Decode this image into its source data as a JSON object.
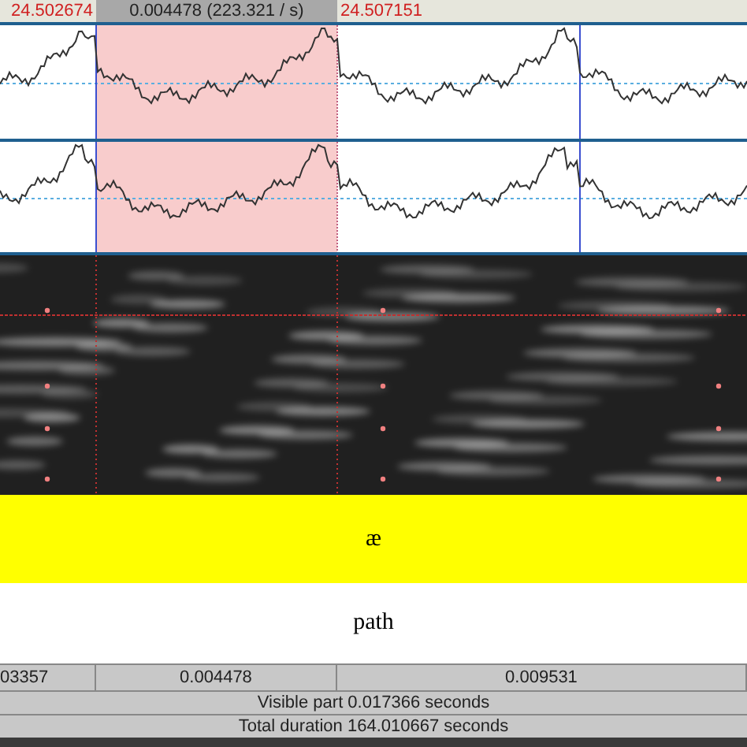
{
  "header": {
    "start_time": "24.502674",
    "selection_duration": "0.004478 (223.321 / s)",
    "end_time": "24.507151"
  },
  "channels": [
    {
      "kind": "waveform"
    },
    {
      "kind": "waveform"
    }
  ],
  "tiers": [
    {
      "text": "æ",
      "selected": true
    },
    {
      "text": "path",
      "selected": false
    }
  ],
  "durations": [
    "03357",
    "0.004478",
    "0.009531"
  ],
  "visible_part": "Visible part 0.017366 seconds",
  "total_duration": "Total duration 164.010667 seconds"
}
